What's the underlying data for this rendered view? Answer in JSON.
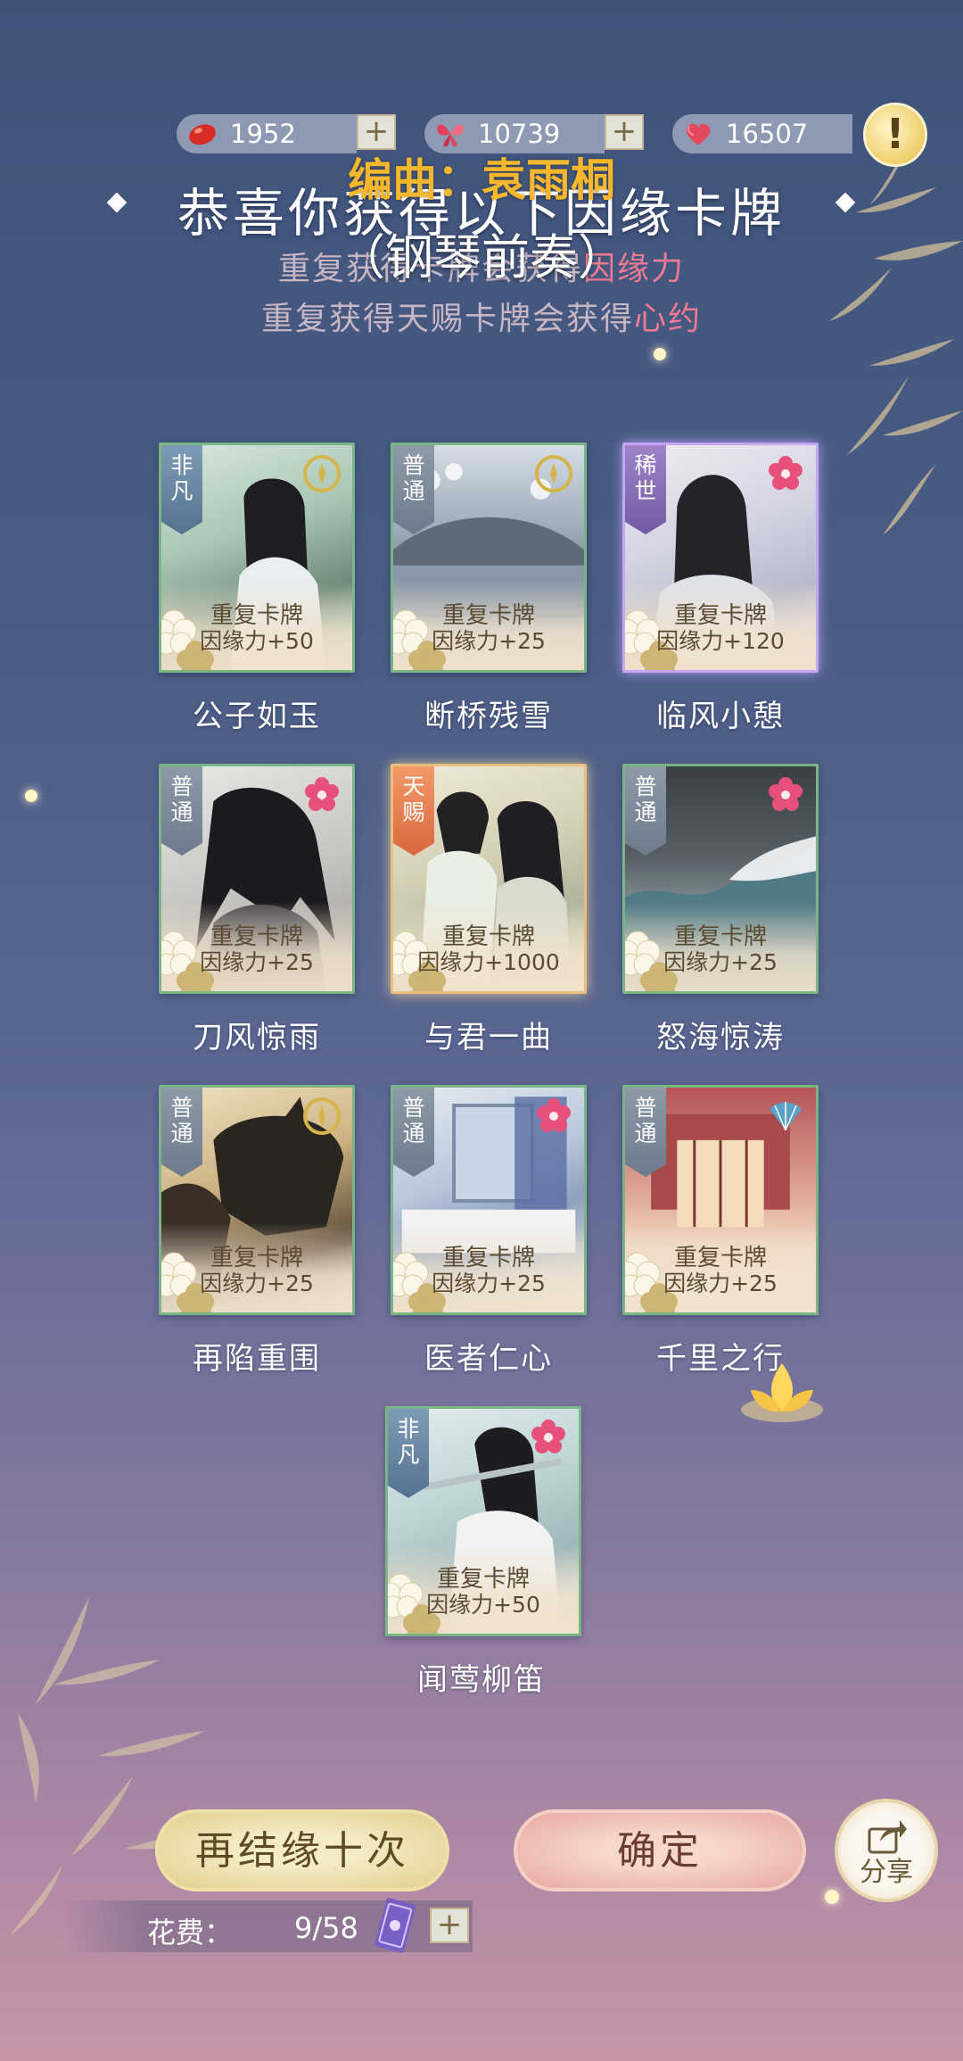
{
  "currency": [
    {
      "name": "red-bean",
      "value": "1952",
      "icon": "red-bean-icon",
      "color": "#d92b25"
    },
    {
      "name": "butterfly",
      "value": "10739",
      "icon": "butterfly-icon",
      "color": "#e0425a"
    },
    {
      "name": "heart",
      "value": "16507",
      "icon": "heart-icon",
      "color": "#e4485d"
    }
  ],
  "plus_label": "+",
  "info_label": "!",
  "header": {
    "title": "恭喜你获得以下因缘卡牌",
    "line1_prefix": "重复获得卡牌会获得",
    "line1_highlight": "因缘力",
    "line2_prefix": "重复获得天赐卡牌会获得",
    "line2_highlight": "心约"
  },
  "overlay": {
    "credit": "编曲：袁雨桐",
    "subtitle": "（钢琴前奏）"
  },
  "cards": [
    {
      "name": "公子如玉",
      "rarity": "非凡",
      "dup_line1": "重复卡牌",
      "dup_line2": "因缘力+50"
    },
    {
      "name": "断桥残雪",
      "rarity": "普通",
      "dup_line1": "重复卡牌",
      "dup_line2": "因缘力+25"
    },
    {
      "name": "临风小憩",
      "rarity": "稀世",
      "dup_line1": "重复卡牌",
      "dup_line2": "因缘力+120"
    },
    {
      "name": "刀风惊雨",
      "rarity": "普通",
      "dup_line1": "重复卡牌",
      "dup_line2": "因缘力+25"
    },
    {
      "name": "与君一曲",
      "rarity": "天赐",
      "dup_line1": "重复卡牌",
      "dup_line2": "因缘力+1000"
    },
    {
      "name": "怒海惊涛",
      "rarity": "普通",
      "dup_line1": "重复卡牌",
      "dup_line2": "因缘力+25"
    },
    {
      "name": "再陷重围",
      "rarity": "普通",
      "dup_line1": "重复卡牌",
      "dup_line2": "因缘力+25"
    },
    {
      "name": "医者仁心",
      "rarity": "普通",
      "dup_line1": "重复卡牌",
      "dup_line2": "因缘力+25"
    },
    {
      "name": "千里之行",
      "rarity": "普通",
      "dup_line1": "重复卡牌",
      "dup_line2": "因缘力+25"
    },
    {
      "name": "闻莺柳笛",
      "rarity": "非凡",
      "dup_line1": "重复卡牌",
      "dup_line2": "因缘力+50"
    }
  ],
  "buttons": {
    "again": "再结缘十次",
    "confirm": "确定",
    "share": "分享"
  },
  "cost": {
    "label": "花费：",
    "value": "9/58",
    "item_icon": "purple-ticket-icon"
  }
}
